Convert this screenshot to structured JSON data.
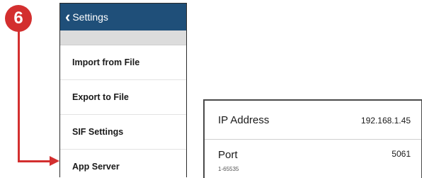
{
  "callout": {
    "step": "6"
  },
  "settings_panel": {
    "back_label": "Settings",
    "items": [
      {
        "label": "Import from File"
      },
      {
        "label": "Export to File"
      },
      {
        "label": "SIF Settings"
      },
      {
        "label": "App Server"
      }
    ]
  },
  "server_detail": {
    "ip": {
      "label": "IP Address",
      "value": "192.168.1.45"
    },
    "port": {
      "label": "Port",
      "range": "1-65535",
      "value": "5061"
    }
  },
  "colors": {
    "header_bg": "#1f4f79",
    "callout_red": "#d32f2f"
  },
  "icons": {
    "back": "chevron-left-icon"
  }
}
